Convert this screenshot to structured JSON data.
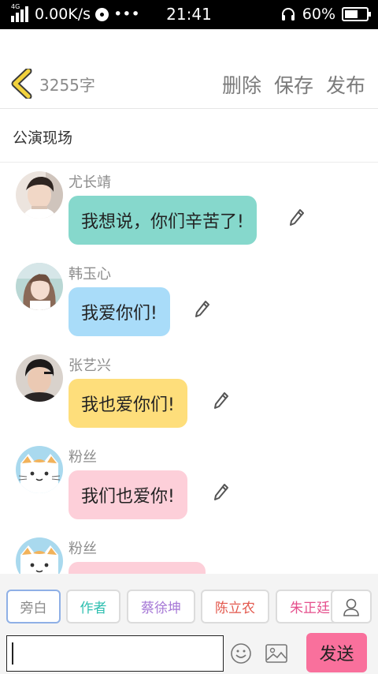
{
  "status_bar": {
    "network_tag": "4G",
    "net_speed": "0.00K/s",
    "more_dots": "•••",
    "time": "21:41",
    "battery": "60%"
  },
  "header": {
    "word_count": "3255字",
    "actions": [
      "删除",
      "保存",
      "发布"
    ]
  },
  "title": "公演现场",
  "messages": [
    {
      "sender": "尤长靖",
      "text": "我想说，你们辛苦了!",
      "bubble_color": "#86d8cc",
      "avatar": "photo-avatar"
    },
    {
      "sender": "韩玉心",
      "text": "我爱你们!",
      "bubble_color": "#a9dcf9",
      "avatar": "photo-avatar"
    },
    {
      "sender": "张艺兴",
      "text": "我也爱你们!",
      "bubble_color": "#fede7b",
      "avatar": "photo-avatar"
    },
    {
      "sender": "粉丝",
      "text": "我们也爱你!",
      "bubble_color": "#fdcfd9",
      "avatar": "cat-avatar"
    },
    {
      "sender": "粉丝",
      "text": "",
      "bubble_color": "#fdcfd9",
      "avatar": "cat-avatar"
    }
  ],
  "roles": [
    {
      "label": "旁白",
      "color": "#8a8a8a"
    },
    {
      "label": "作者",
      "color": "#2fbfb0"
    },
    {
      "label": "蔡徐坤",
      "color": "#a678d6"
    },
    {
      "label": "陈立农",
      "color": "#e2574c"
    },
    {
      "label": "朱正廷",
      "color": "#e54f8c"
    }
  ],
  "input": {
    "value": "",
    "send_label": "发送"
  },
  "colors": {
    "send_button": "#f9709c",
    "back_arrow": "#f2d23c"
  }
}
